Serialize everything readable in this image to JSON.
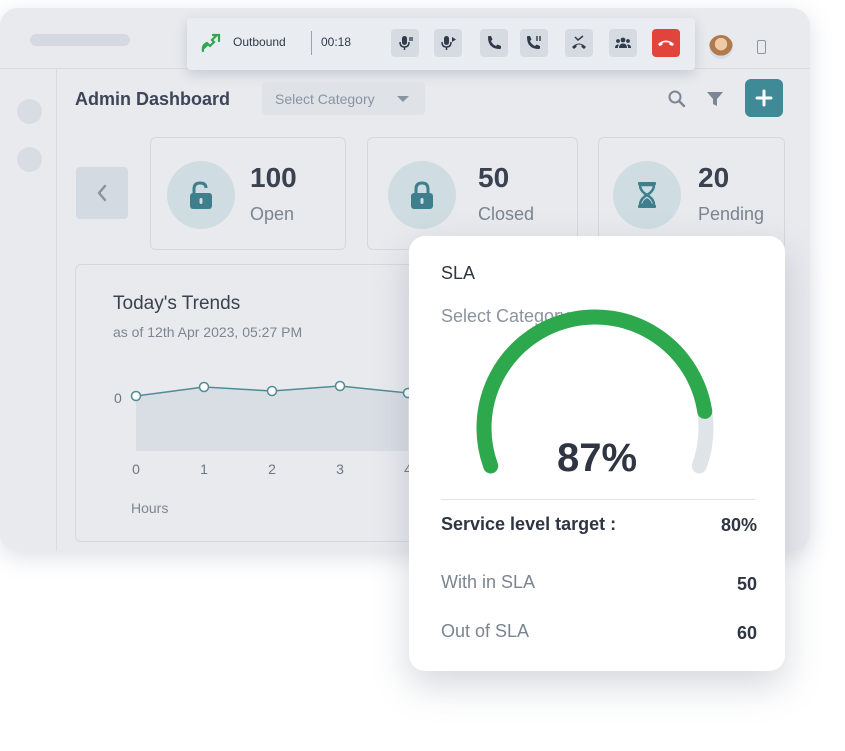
{
  "callbar": {
    "status": "Outbound",
    "timer": "00:18",
    "buttons": [
      "mute-icon",
      "record-icon",
      "hold-icon",
      "transfer-icon",
      "merge-icon",
      "conference-icon",
      "hang-up-icon"
    ]
  },
  "header": {
    "title": "Admin Dashboard",
    "category_placeholder": "Select Category"
  },
  "stats": [
    {
      "value": "100",
      "label": "Open",
      "icon": "unlock-icon"
    },
    {
      "value": "50",
      "label": "Closed",
      "icon": "lock-icon"
    },
    {
      "value": "20",
      "label": "Pending",
      "icon": "hourglass-icon"
    }
  ],
  "trends": {
    "title": "Today's Trends",
    "subtitle": "as of 12th Apr 2023, 05:27 PM",
    "xlabel": "Hours"
  },
  "chart_data": {
    "type": "area",
    "x": [
      0,
      1,
      2,
      3,
      4
    ],
    "tick_labels_x": [
      "0",
      "1",
      "2",
      "3",
      "4"
    ],
    "tick_labels_y": [
      "0"
    ],
    "values": [
      0,
      0,
      0,
      0,
      0
    ],
    "xlabel": "Hours"
  },
  "sla": {
    "title": "SLA",
    "category_placeholder": "Select Category",
    "percent": 87,
    "percent_label": "87%",
    "target_label": "Service level target :",
    "target_value": "80%",
    "within_label": "With in SLA",
    "within_value": "50",
    "out_label": "Out of SLA",
    "out_value": "60"
  },
  "colors": {
    "accent": "#3f8a96",
    "gauge": "#2ea84d",
    "end_call": "#e0443a"
  }
}
